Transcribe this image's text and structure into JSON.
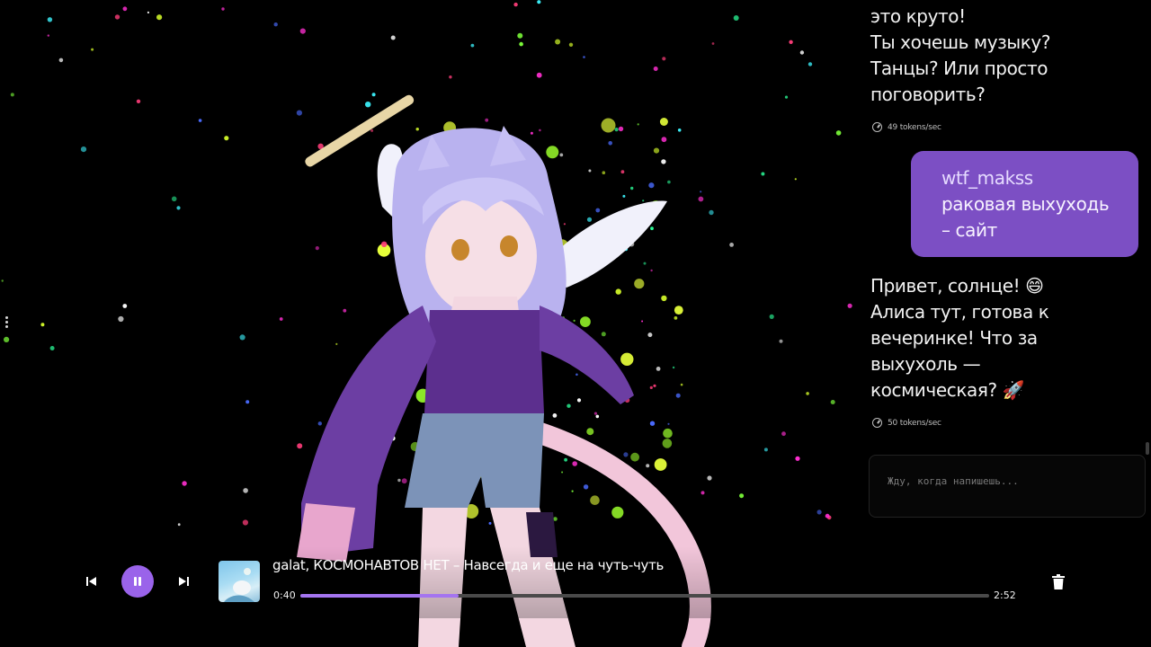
{
  "chat": {
    "top_message": {
      "lines": [
        "это круто!",
        "Ты хочешь музыку?",
        "Танцы? Или просто",
        "поговорить?"
      ],
      "speed": "49 tokens/sec"
    },
    "user_message": {
      "username": "wtf_makss",
      "lines": [
        "раковая  выхуходь",
        "– сайт"
      ]
    },
    "reply_message": {
      "lines": [
        " Привет, солнце! 😄",
        "Алиса тут, готова к",
        "вечеринке! Что за",
        "выхухоль —",
        "космическая? 🚀"
      ],
      "speed": "50 tokens/sec"
    },
    "input": {
      "placeholder": "Жду, когда напишешь..."
    }
  },
  "player": {
    "track_title": "galat, КОСМОНАВТОВ НЕТ – Навсегда и еще на чуть-чуть",
    "current_time": "0:40",
    "total_time": "2:52",
    "progress": 0.23,
    "state": "playing",
    "icons": {
      "prev": "skip-previous-icon",
      "pause": "pause-icon",
      "next": "skip-next-icon",
      "delete": "trash-icon"
    }
  },
  "colors": {
    "accent": "#9a63ea",
    "user_bubble": "#7c4fc4",
    "background": "#000000"
  }
}
